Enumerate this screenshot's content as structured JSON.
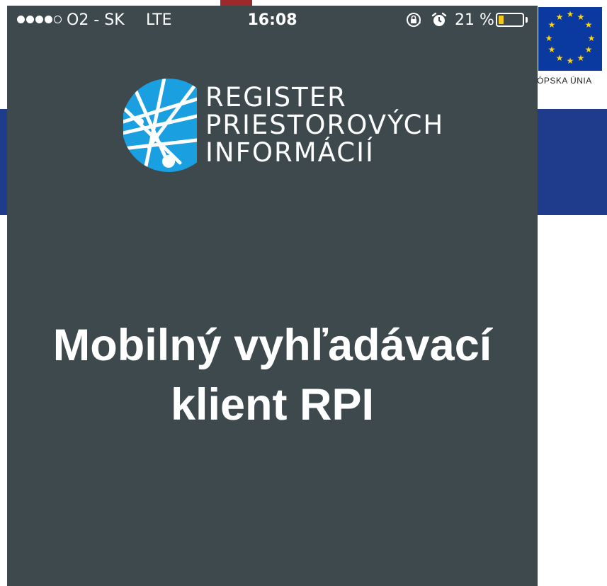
{
  "status_bar": {
    "signal_strength": "4 of 5",
    "carrier": "O2 - SK",
    "network": "LTE",
    "time": "16:08",
    "battery_percent": "21 %",
    "battery_level": 0.21,
    "icons": [
      "rotation-lock-icon",
      "alarm-icon",
      "battery-icon"
    ]
  },
  "logo": {
    "line1": "REGISTER",
    "line2": "PRIESTOROVÝCH",
    "line3": "INFORMÁCIÍ",
    "mark_color": "#1aa0e0"
  },
  "app_title": {
    "line1": "Mobilný vyhľadávací",
    "line2": "klient RPI"
  },
  "background_page": {
    "eu_caption": "ÓPSKA ÚNIA",
    "band_color": "#1f3b8c",
    "eu_flag_color": "#0a3aa0",
    "phone_background": "#3e494d"
  }
}
